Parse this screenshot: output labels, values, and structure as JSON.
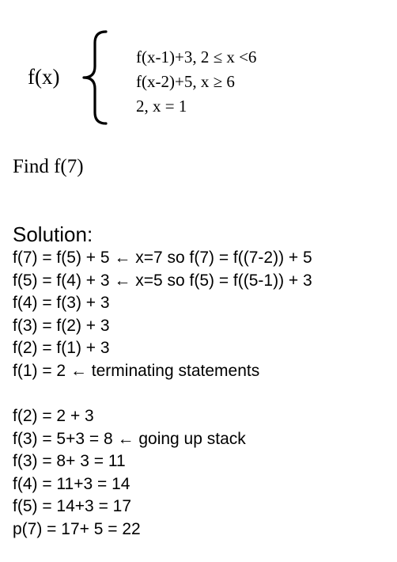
{
  "definition": {
    "function_label": "f(x)",
    "cases": [
      "f(x-1)+3, 2 ≤ x <6",
      "f(x-2)+5, x ≥ 6",
      "2, x = 1"
    ]
  },
  "question": "Find f(7)",
  "solution": {
    "heading": "Solution:",
    "steps": [
      "f(7) = f(5) + 5  ← x=7 so f(7) = f((7-2)) + 5",
      "f(5) = f(4) + 3  ← x=5 so f(5) = f((5-1)) + 3",
      "f(4) = f(3) + 3",
      "f(3) = f(2) + 3",
      "f(2) = f(1) + 3",
      "f(1) = 2 ← terminating statements"
    ],
    "unwind": [
      "f(2) = 2 + 3",
      "f(3) = 5+3 = 8 ← going up stack",
      "f(3) = 8+ 3 = 11",
      "f(4) = 11+3 = 14",
      "f(5) = 14+3 = 17",
      "p(7) = 17+ 5 = 22"
    ]
  }
}
